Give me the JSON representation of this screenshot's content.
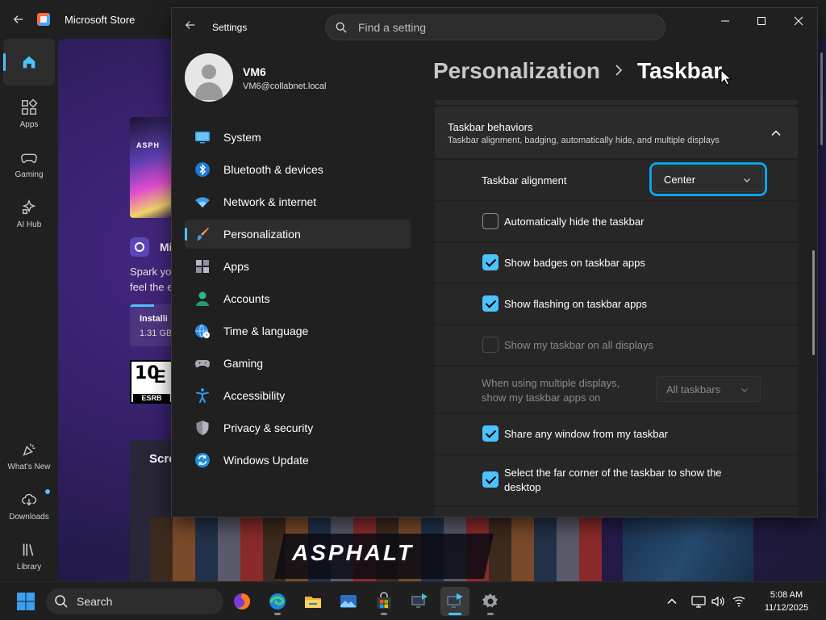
{
  "store": {
    "title": "Microsoft Store",
    "rail": {
      "apps": "Apps",
      "gaming": "Gaming",
      "ai_hub": "AI Hub",
      "whats_new": "What's New",
      "downloads": "Downloads",
      "library": "Library"
    },
    "game": {
      "art_label": "ASPH",
      "name_fragment": "Mi",
      "desc_line1": "Spark yo",
      "desc_line2": "feel the e",
      "install_label": "Installi",
      "install_size": "1.31 GB",
      "install_progress": 0.5,
      "esrb_age": "10",
      "esrb_e": "E",
      "esrb_label": "ESRB",
      "screens_label": "Scre",
      "banner_text": "ASPHALT"
    }
  },
  "settings": {
    "window_title": "Settings",
    "search_placeholder": "Find a setting",
    "profile": {
      "name": "VM6",
      "email": "VM6@collabnet.local"
    },
    "nav": [
      {
        "label": "System",
        "icon": "system-icon",
        "active": false
      },
      {
        "label": "Bluetooth & devices",
        "icon": "bluetooth-icon",
        "active": false
      },
      {
        "label": "Network & internet",
        "icon": "wifi-icon",
        "active": false
      },
      {
        "label": "Personalization",
        "icon": "brush-icon",
        "active": true
      },
      {
        "label": "Apps",
        "icon": "apps-icon",
        "active": false
      },
      {
        "label": "Accounts",
        "icon": "accounts-icon",
        "active": false
      },
      {
        "label": "Time & language",
        "icon": "globe-clock-icon",
        "active": false
      },
      {
        "label": "Gaming",
        "icon": "gamepad-icon",
        "active": false
      },
      {
        "label": "Accessibility",
        "icon": "accessibility-icon",
        "active": false
      },
      {
        "label": "Privacy & security",
        "icon": "shield-icon",
        "active": false
      },
      {
        "label": "Windows Update",
        "icon": "update-icon",
        "active": false
      }
    ],
    "breadcrumb": {
      "parent": "Personalization",
      "separator": ">",
      "current": "Taskbar"
    },
    "behaviors": {
      "title": "Taskbar behaviors",
      "description": "Taskbar alignment, badging, automatically hide, and multiple displays",
      "alignment_label": "Taskbar alignment",
      "alignment_value": "Center",
      "options": [
        {
          "label": "Automatically hide the taskbar",
          "checked": false,
          "disabled": false
        },
        {
          "label": "Show badges on taskbar apps",
          "checked": true,
          "disabled": false
        },
        {
          "label": "Show flashing on taskbar apps",
          "checked": true,
          "disabled": false
        },
        {
          "label": "Show my taskbar on all displays",
          "checked": false,
          "disabled": true
        }
      ],
      "multi_display_line1": "When using multiple displays,",
      "multi_display_line2": "show my taskbar apps on",
      "multi_display_value": "All taskbars",
      "share_window": {
        "label": "Share any window from my taskbar",
        "checked": true
      },
      "far_corner": {
        "line1": "Select the far corner of the taskbar to show the",
        "line2": "desktop",
        "checked": true
      }
    }
  },
  "taskbar": {
    "search_label": "Search",
    "apps": [
      {
        "name": "firefox-icon",
        "active": false,
        "running": false
      },
      {
        "name": "edge-icon",
        "active": false,
        "running": true
      },
      {
        "name": "file-explorer-icon",
        "active": false,
        "running": false
      },
      {
        "name": "photos-icon",
        "active": false,
        "running": false
      },
      {
        "name": "store-icon",
        "active": false,
        "running": true
      },
      {
        "name": "remote-desktop-icon",
        "active": false,
        "running": false
      },
      {
        "name": "remote-connection-icon",
        "active": true,
        "running": true
      },
      {
        "name": "settings-icon",
        "active": false,
        "running": true
      }
    ],
    "clock": {
      "time": "5:08 AM",
      "date": "11/12/2025"
    }
  },
  "colors": {
    "accent": "#4cc2ff",
    "focus_ring": "#0ea2e8",
    "window_bg": "#202020",
    "card_bg": "#272727"
  }
}
